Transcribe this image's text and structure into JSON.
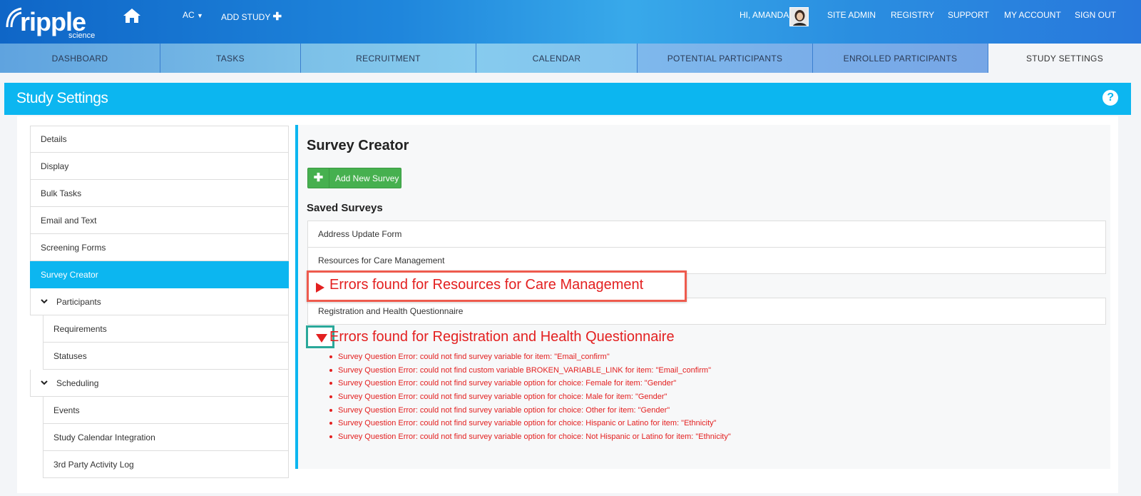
{
  "header": {
    "logo_text": "ripple",
    "logo_sub": "science",
    "study_menu": "AC",
    "add_study": "ADD STUDY",
    "greeting": "HI, AMANDA",
    "links": [
      "SITE ADMIN",
      "REGISTRY",
      "SUPPORT",
      "MY ACCOUNT",
      "SIGN OUT"
    ]
  },
  "nav": {
    "tabs": [
      {
        "label": "DASHBOARD"
      },
      {
        "label": "TASKS"
      },
      {
        "label": "RECRUITMENT"
      },
      {
        "label": "CALENDAR"
      },
      {
        "label": "POTENTIAL PARTICIPANTS"
      },
      {
        "label": "ENROLLED PARTICIPANTS"
      },
      {
        "label": "STUDY SETTINGS"
      }
    ]
  },
  "page_title": "Study Settings",
  "sidebar": {
    "items": [
      {
        "label": "Details"
      },
      {
        "label": "Display"
      },
      {
        "label": "Bulk Tasks"
      },
      {
        "label": "Email and Text"
      },
      {
        "label": "Screening Forms"
      },
      {
        "label": "Survey Creator"
      },
      {
        "label": "Participants"
      },
      {
        "label": "Requirements"
      },
      {
        "label": "Statuses"
      },
      {
        "label": "Scheduling"
      },
      {
        "label": "Events"
      },
      {
        "label": "Study Calendar Integration"
      },
      {
        "label": "3rd Party Activity Log"
      }
    ]
  },
  "content": {
    "title": "Survey Creator",
    "add_button": "Add New Survey",
    "saved_title": "Saved Surveys",
    "surveys": [
      {
        "name": "Address Update Form"
      },
      {
        "name": "Resources for Care Management"
      },
      {
        "name": "Registration and Health Questionnaire"
      }
    ],
    "error_header_1": "Errors found for Resources for Care Management",
    "error_header_2": "Errors found for Registration and Health Questionnaire",
    "errors": [
      "Survey Question Error: could not find survey variable for item: \"Email_confirm\"",
      "Survey Question Error: could not find custom variable BROKEN_VARIABLE_LINK for item: \"Email_confirm\"",
      "Survey Question Error: could not find survey variable option for choice: Female for item: \"Gender\"",
      "Survey Question Error: could not find survey variable option for choice: Male for item: \"Gender\"",
      "Survey Question Error: could not find survey variable option for choice: Other for item: \"Gender\"",
      "Survey Question Error: could not find survey variable option for choice: Hispanic or Latino for item: \"Ethnicity\"",
      "Survey Question Error: could not find survey variable option for choice: Not Hispanic or Latino for item: \"Ethnicity\""
    ]
  },
  "colors": {
    "accent": "#0cb6f0",
    "error": "#e32020",
    "success": "#46b04f"
  }
}
